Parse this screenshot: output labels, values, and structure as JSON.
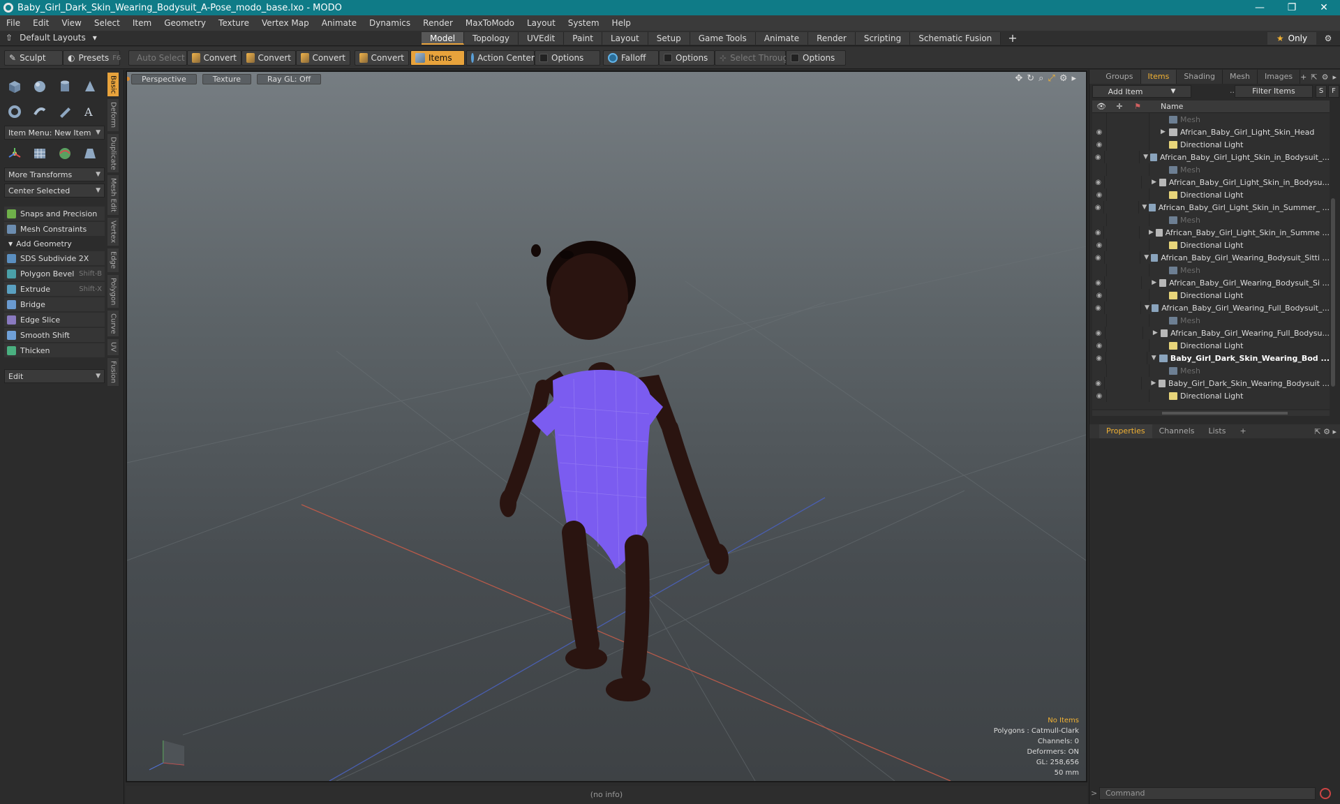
{
  "window": {
    "title": "Baby_Girl_Dark_Skin_Wearing_Bodysuit_A-Pose_modo_base.lxo - MODO",
    "minimize": "—",
    "maximize": "❐",
    "close": "✕"
  },
  "menu": [
    "File",
    "Edit",
    "View",
    "Select",
    "Item",
    "Geometry",
    "Texture",
    "Vertex Map",
    "Animate",
    "Dynamics",
    "Render",
    "MaxToModo",
    "Layout",
    "System",
    "Help"
  ],
  "layout": {
    "default_layouts": "Default Layouts",
    "tabs": [
      "Model",
      "Topology",
      "UVEdit",
      "Paint",
      "Layout",
      "Setup",
      "Game Tools",
      "Animate",
      "Render",
      "Scripting",
      "Schematic Fusion"
    ],
    "active_tab": "Model",
    "plus": "+",
    "only": "Only"
  },
  "toolbar": {
    "sculpt": "Sculpt",
    "presets": "Presets",
    "presets_key": "F6",
    "auto_select": "Auto Select",
    "convert1": "Convert",
    "convert2": "Convert",
    "convert3": "Convert",
    "convert4": "Convert",
    "items": "Items",
    "action_center": "Action Center",
    "options1": "Options",
    "falloff": "Falloff",
    "options2": "Options",
    "select_through": "Select Through",
    "options3": "Options"
  },
  "left": {
    "item_menu": "Item Menu: New Item",
    "more_transforms": "More Transforms",
    "center_selected": "Center Selected",
    "snaps": "Snaps and Precision",
    "mesh_constraints": "Mesh Constraints",
    "add_geometry": "Add Geometry",
    "tools": [
      {
        "label": "SDS Subdivide 2X",
        "shortcut": ""
      },
      {
        "label": "Polygon Bevel",
        "shortcut": "Shift-B"
      },
      {
        "label": "Extrude",
        "shortcut": "Shift-X"
      },
      {
        "label": "Bridge",
        "shortcut": ""
      },
      {
        "label": "Edge Slice",
        "shortcut": ""
      },
      {
        "label": "Smooth Shift",
        "shortcut": ""
      },
      {
        "label": "Thicken",
        "shortcut": ""
      }
    ],
    "edit": "Edit",
    "vtabs": [
      "Basic",
      "Deform",
      "Duplicate",
      "Mesh Edit",
      "Vertex",
      "Edge",
      "Polygon",
      "Curve",
      "UV",
      "Fusion"
    ]
  },
  "viewport": {
    "perspective": "Perspective",
    "texture": "Texture",
    "raygl": "Ray GL: Off",
    "info": {
      "no_items": "No Items",
      "polygons": "Polygons : Catmull-Clark",
      "channels": "Channels: 0",
      "deformers": "Deformers: ON",
      "gl": "GL: 258,656",
      "mm": "50 mm"
    },
    "status": "(no info)"
  },
  "right": {
    "tabs": [
      "Groups",
      "Items",
      "Shading",
      "Mesh ...",
      "Images"
    ],
    "active_tab": "Items",
    "add_item": "Add Item",
    "filter_items": "Filter Items",
    "s": "S",
    "f": "F",
    "name_col": "Name",
    "rows": [
      {
        "label": "Mesh",
        "type": "mesh",
        "level": 2,
        "dim": true,
        "arrow": ""
      },
      {
        "label": "African_Baby_Girl_Light_Skin_Head",
        "type": "group",
        "level": 2,
        "arrow": "▶"
      },
      {
        "label": "Directional Light",
        "type": "light",
        "level": 2,
        "arrow": ""
      },
      {
        "label": "African_Baby_Girl_Light_Skin_in_Bodysuit_...",
        "type": "scene",
        "level": 1,
        "arrow": "▼"
      },
      {
        "label": "Mesh",
        "type": "mesh",
        "level": 2,
        "dim": true,
        "arrow": ""
      },
      {
        "label": "African_Baby_Girl_Light_Skin_in_Bodysu...",
        "type": "group",
        "level": 2,
        "arrow": "▶"
      },
      {
        "label": "Directional Light",
        "type": "light",
        "level": 2,
        "arrow": ""
      },
      {
        "label": "African_Baby_Girl_Light_Skin_in_Summer_ ...",
        "type": "scene",
        "level": 1,
        "arrow": "▼"
      },
      {
        "label": "Mesh",
        "type": "mesh",
        "level": 2,
        "dim": true,
        "arrow": ""
      },
      {
        "label": "African_Baby_Girl_Light_Skin_in_Summe ...",
        "type": "group",
        "level": 2,
        "arrow": "▶"
      },
      {
        "label": "Directional Light",
        "type": "light",
        "level": 2,
        "arrow": ""
      },
      {
        "label": "African_Baby_Girl_Wearing_Bodysuit_Sitti ...",
        "type": "scene",
        "level": 1,
        "arrow": "▼"
      },
      {
        "label": "Mesh",
        "type": "mesh",
        "level": 2,
        "dim": true,
        "arrow": ""
      },
      {
        "label": "African_Baby_Girl_Wearing_Bodysuit_Si ...",
        "type": "group",
        "level": 2,
        "arrow": "▶"
      },
      {
        "label": "Directional Light",
        "type": "light",
        "level": 2,
        "arrow": ""
      },
      {
        "label": "African_Baby_Girl_Wearing_Full_Bodysuit_...",
        "type": "scene",
        "level": 1,
        "arrow": "▼"
      },
      {
        "label": "Mesh",
        "type": "mesh",
        "level": 2,
        "dim": true,
        "arrow": ""
      },
      {
        "label": "African_Baby_Girl_Wearing_Full_Bodysu...",
        "type": "group",
        "level": 2,
        "arrow": "▶"
      },
      {
        "label": "Directional Light",
        "type": "light",
        "level": 2,
        "arrow": ""
      },
      {
        "label": "Baby_Girl_Dark_Skin_Wearing_Bod ...",
        "type": "scene",
        "level": 1,
        "arrow": "▼",
        "bold": true
      },
      {
        "label": "Mesh",
        "type": "mesh",
        "level": 2,
        "dim": true,
        "arrow": ""
      },
      {
        "label": "Baby_Girl_Dark_Skin_Wearing_Bodysuit ...",
        "type": "group",
        "level": 2,
        "arrow": "▶"
      },
      {
        "label": "Directional Light",
        "type": "light",
        "level": 2,
        "arrow": ""
      }
    ],
    "prop_tabs": [
      "Properties",
      "Channels",
      "Lists"
    ],
    "prop_active": "Properties",
    "command_placeholder": "Command"
  },
  "colors": {
    "title_bg": "#0f7b87",
    "accent": "#e8a33c",
    "bodysuit": "#7b5cf0",
    "skin": "#2a1410"
  }
}
